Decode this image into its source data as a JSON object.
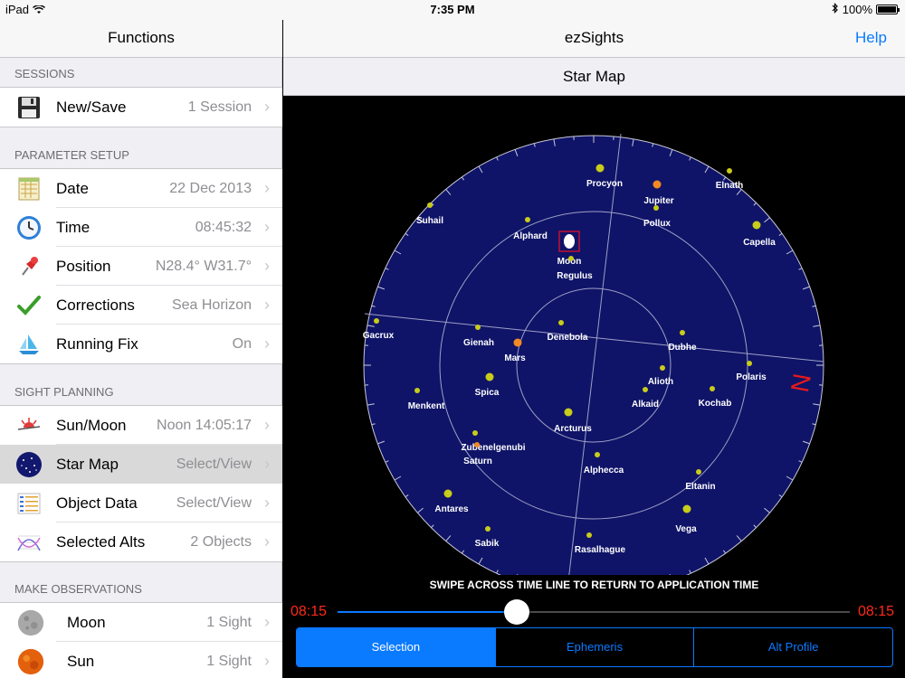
{
  "status": {
    "device": "iPad",
    "time": "7:35 PM",
    "battery": "100%"
  },
  "left_nav": {
    "title": "Functions"
  },
  "sections": {
    "sessions": "SESSIONS",
    "parameter_setup": "PARAMETER SETUP",
    "sight_planning": "SIGHT PLANNING",
    "make_observations": "MAKE OBSERVATIONS"
  },
  "rows": {
    "new_save": {
      "label": "New/Save",
      "value": "1 Session"
    },
    "date": {
      "label": "Date",
      "value": "22 Dec 2013"
    },
    "time": {
      "label": "Time",
      "value": "08:45:32"
    },
    "position": {
      "label": "Position",
      "value": "N28.4° W31.7°"
    },
    "corrections": {
      "label": "Corrections",
      "value": "Sea Horizon"
    },
    "running_fix": {
      "label": "Running Fix",
      "value": "On"
    },
    "sun_moon": {
      "label": "Sun/Moon",
      "value": "Noon 14:05:17"
    },
    "star_map": {
      "label": "Star Map",
      "value": "Select/View"
    },
    "object_data": {
      "label": "Object Data",
      "value": "Select/View"
    },
    "selected_alts": {
      "label": "Selected Alts",
      "value": "2 Objects"
    },
    "moon": {
      "label": "Moon",
      "value": "1 Sight"
    },
    "sun": {
      "label": "Sun",
      "value": "1 Sight"
    }
  },
  "right_nav": {
    "title": "ezSights",
    "help": "Help"
  },
  "subheader": "Star Map",
  "star_map": {
    "compass_label": "N",
    "stars": [
      {
        "name": "Procyon",
        "kind": "star"
      },
      {
        "name": "Jupiter",
        "kind": "planet"
      },
      {
        "name": "Elnath",
        "kind": "star"
      },
      {
        "name": "Pollux",
        "kind": "star"
      },
      {
        "name": "Capella",
        "kind": "star"
      },
      {
        "name": "Suhail",
        "kind": "star"
      },
      {
        "name": "Alphard",
        "kind": "star"
      },
      {
        "name": "Moon",
        "kind": "moon"
      },
      {
        "name": "Regulus",
        "kind": "star"
      },
      {
        "name": "Gacrux",
        "kind": "star"
      },
      {
        "name": "Gienah",
        "kind": "star"
      },
      {
        "name": "Denebola",
        "kind": "star"
      },
      {
        "name": "Dubhe",
        "kind": "star"
      },
      {
        "name": "Mars",
        "kind": "planet"
      },
      {
        "name": "Polaris",
        "kind": "star"
      },
      {
        "name": "Spica",
        "kind": "star"
      },
      {
        "name": "Alioth",
        "kind": "star"
      },
      {
        "name": "Menkent",
        "kind": "star"
      },
      {
        "name": "Alkaid",
        "kind": "star"
      },
      {
        "name": "Kochab",
        "kind": "star"
      },
      {
        "name": "Arcturus",
        "kind": "star"
      },
      {
        "name": "Zubenelgenubi",
        "kind": "star"
      },
      {
        "name": "Saturn",
        "kind": "planet"
      },
      {
        "name": "Alphecca",
        "kind": "star"
      },
      {
        "name": "Eltanin",
        "kind": "star"
      },
      {
        "name": "Antares",
        "kind": "star"
      },
      {
        "name": "Vega",
        "kind": "star"
      },
      {
        "name": "Sabik",
        "kind": "star"
      },
      {
        "name": "Rasalhague",
        "kind": "star"
      }
    ]
  },
  "timeline": {
    "instruction": "SWIPE ACROSS TIME LINE TO RETURN TO APPLICATION TIME",
    "left_time": "08:15",
    "right_time": "08:15",
    "position": 0.35
  },
  "tabs": [
    {
      "label": "Selection",
      "active": true
    },
    {
      "label": "Ephemeris",
      "active": false
    },
    {
      "label": "Alt Profile",
      "active": false
    }
  ],
  "colors": {
    "accent": "#0a7aff",
    "map_bg": "#0f1468",
    "star": "#c8cc1a",
    "planet": "#f28a24",
    "time_red": "#ff2a1a"
  }
}
